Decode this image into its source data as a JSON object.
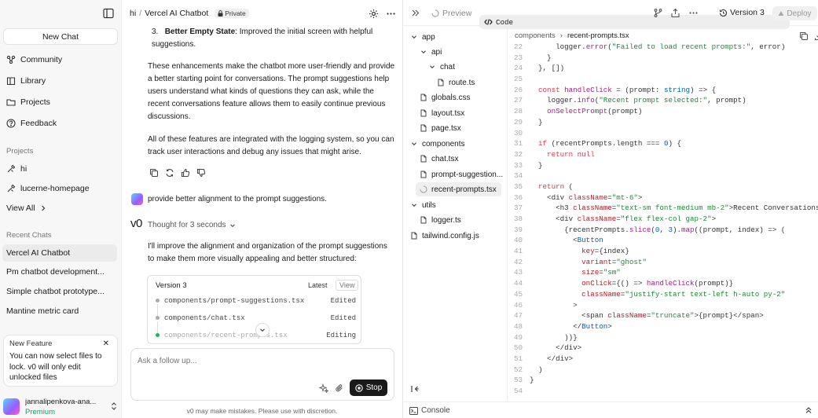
{
  "sidebar": {
    "new_chat": "New Chat",
    "nav": [
      "Community",
      "Library",
      "Projects",
      "Feedback"
    ],
    "projects_header": "Projects",
    "projects": [
      "hi",
      "lucerne-homepage"
    ],
    "view_all": "View All",
    "recent_header": "Recent Chats",
    "recent": [
      "Vercel AI Chatbot",
      "Pm chatbot development...",
      "Simple chatbot prototype...",
      "Mantine metric card"
    ],
    "notice": {
      "title": "New Feature",
      "body": "You can now select files to lock. v0 will only edit unlocked files"
    },
    "user": {
      "name": "jannalipenkova-ana...",
      "plan": "Premium"
    }
  },
  "chat": {
    "breadcrumb": {
      "project": "hi",
      "chat": "Vercel AI Chatbot",
      "visibility": "Private"
    },
    "list_item_num": "3.",
    "list_item_bold": "Better Empty State",
    "list_item_text": ": Improved the initial screen with helpful suggestions.",
    "para1": "These enhancements make the chatbot more user-friendly and provide a better starting point for conversations. The prompt suggestions help users understand what kinds of questions they can ask, while the recent conversations feature allows them to easily continue previous discussions.",
    "para2": "All of these features are integrated with the logging system, so you can track user interactions and debug any issues that might arise.",
    "user_message": "provide better alignment to the prompt suggestions.",
    "assistant_logo": "v0",
    "thought": "Thought for 3 seconds",
    "assistant_text": "I'll improve the alignment and organization of the prompt suggestions to make them more visually appealing and better structured:",
    "version_card": {
      "title": "Version 3",
      "latest": "Latest",
      "view": "View",
      "files": [
        {
          "path": "components/prompt-suggestions.tsx",
          "status": "Edited"
        },
        {
          "path": "components/chat.tsx",
          "status": "Edited"
        },
        {
          "path": "components/recent-prompts.tsx",
          "status": "Editing"
        }
      ]
    },
    "input_placeholder": "Ask a follow up...",
    "stop_label": "Stop",
    "disclaimer": "v0 may make mistakes. Please use with discretion."
  },
  "panel": {
    "preview_tab": "Preview",
    "code_tab": "Code",
    "version": "Version 3",
    "deploy": "Deploy",
    "tree": [
      {
        "name": "app",
        "type": "folder",
        "depth": 0
      },
      {
        "name": "api",
        "type": "folder",
        "depth": 1
      },
      {
        "name": "chat",
        "type": "folder",
        "depth": 2
      },
      {
        "name": "route.ts",
        "type": "file",
        "depth": 3
      },
      {
        "name": "globals.css",
        "type": "file",
        "depth": 1
      },
      {
        "name": "layout.tsx",
        "type": "file",
        "depth": 1
      },
      {
        "name": "page.tsx",
        "type": "file",
        "depth": 1
      },
      {
        "name": "components",
        "type": "folder",
        "depth": 0
      },
      {
        "name": "chat.tsx",
        "type": "file",
        "depth": 1
      },
      {
        "name": "prompt-suggestion...",
        "type": "file",
        "depth": 1
      },
      {
        "name": "recent-prompts.tsx",
        "type": "loading",
        "depth": 1,
        "selected": true
      },
      {
        "name": "utils",
        "type": "folder",
        "depth": 0
      },
      {
        "name": "logger.ts",
        "type": "file",
        "depth": 1
      },
      {
        "name": "tailwind.config.js",
        "type": "file",
        "depth": 0
      }
    ],
    "editor_crumb": {
      "dir": "components",
      "file": "recent-prompts.tsx"
    },
    "console": "Console",
    "code_lines": [
      {
        "n": "22",
        "html": "      logger.<span class=\"f\">error</span>(<span class=\"s\">\"Failed to load recent prompts:\"</span>, error)"
      },
      {
        "n": "23",
        "html": "    }"
      },
      {
        "n": "24",
        "html": "  }, [])"
      },
      {
        "n": "25",
        "html": ""
      },
      {
        "n": "26",
        "html": "  <span class=\"k\">const</span> <span class=\"f\">handleClick</span> = (prompt: <span class=\"n\">string</span>) => {"
      },
      {
        "n": "27",
        "html": "    logger.<span class=\"f\">info</span>(<span class=\"s\">\"Recent prompt selected:\"</span>, prompt)"
      },
      {
        "n": "28",
        "html": "    <span class=\"f\">onSelectPrompt</span>(prompt)"
      },
      {
        "n": "29",
        "html": "  }"
      },
      {
        "n": "30",
        "html": ""
      },
      {
        "n": "31",
        "html": "  <span class=\"k\">if</span> (recentPrompts.length === <span class=\"n\">0</span>) {"
      },
      {
        "n": "32",
        "html": "    <span class=\"k\">return</span> <span class=\"k\">null</span>"
      },
      {
        "n": "33",
        "html": "  }"
      },
      {
        "n": "34",
        "html": ""
      },
      {
        "n": "35",
        "html": "  <span class=\"k\">return</span> ("
      },
      {
        "n": "36",
        "html": "    &lt;div <span class=\"a\">className</span>=<span class=\"s\">\"mt-6\"</span>&gt;"
      },
      {
        "n": "37",
        "html": "      &lt;h3 <span class=\"a\">className</span>=<span class=\"s\">\"text-sm font-medium mb-2\"</span>&gt;Recent Conversations&lt;/h3&gt;"
      },
      {
        "n": "38",
        "html": "      &lt;div <span class=\"a\">className</span>=<span class=\"s\">\"flex flex-col gap-2\"</span>&gt;"
      },
      {
        "n": "39",
        "html": "        {recentPrompts.<span class=\"f\">slice</span>(<span class=\"n\">0</span>, <span class=\"n\">3</span>).<span class=\"f\">map</span>((prompt, index) => ("
      },
      {
        "n": "40",
        "html": "          &lt;<span class=\"n\">Button</span>"
      },
      {
        "n": "41",
        "html": "            <span class=\"a\">key</span>={index}"
      },
      {
        "n": "42",
        "html": "            <span class=\"a\">variant</span>=<span class=\"s\">\"ghost\"</span>"
      },
      {
        "n": "43",
        "html": "            <span class=\"a\">size</span>=<span class=\"s\">\"sm\"</span>"
      },
      {
        "n": "44",
        "html": "            <span class=\"a\">onClick</span>={() => <span class=\"f\">handleClick</span>(prompt)}"
      },
      {
        "n": "45",
        "html": "            <span class=\"a\">className</span>=<span class=\"s\">\"justify-start text-left h-auto py-2\"</span>"
      },
      {
        "n": "46",
        "html": "          &gt;"
      },
      {
        "n": "47",
        "html": "            &lt;span <span class=\"a\">className</span>=<span class=\"s\">\"truncate\"</span>&gt;{prompt}&lt;/span&gt;"
      },
      {
        "n": "48",
        "html": "          &lt;/<span class=\"n\">Button</span>&gt;"
      },
      {
        "n": "49",
        "html": "        ))}"
      },
      {
        "n": "50",
        "html": "      &lt;/div&gt;"
      },
      {
        "n": "51",
        "html": "    &lt;/div&gt;"
      },
      {
        "n": "52",
        "html": "  )"
      },
      {
        "n": "53",
        "html": "}"
      },
      {
        "n": "54",
        "html": ""
      }
    ]
  }
}
